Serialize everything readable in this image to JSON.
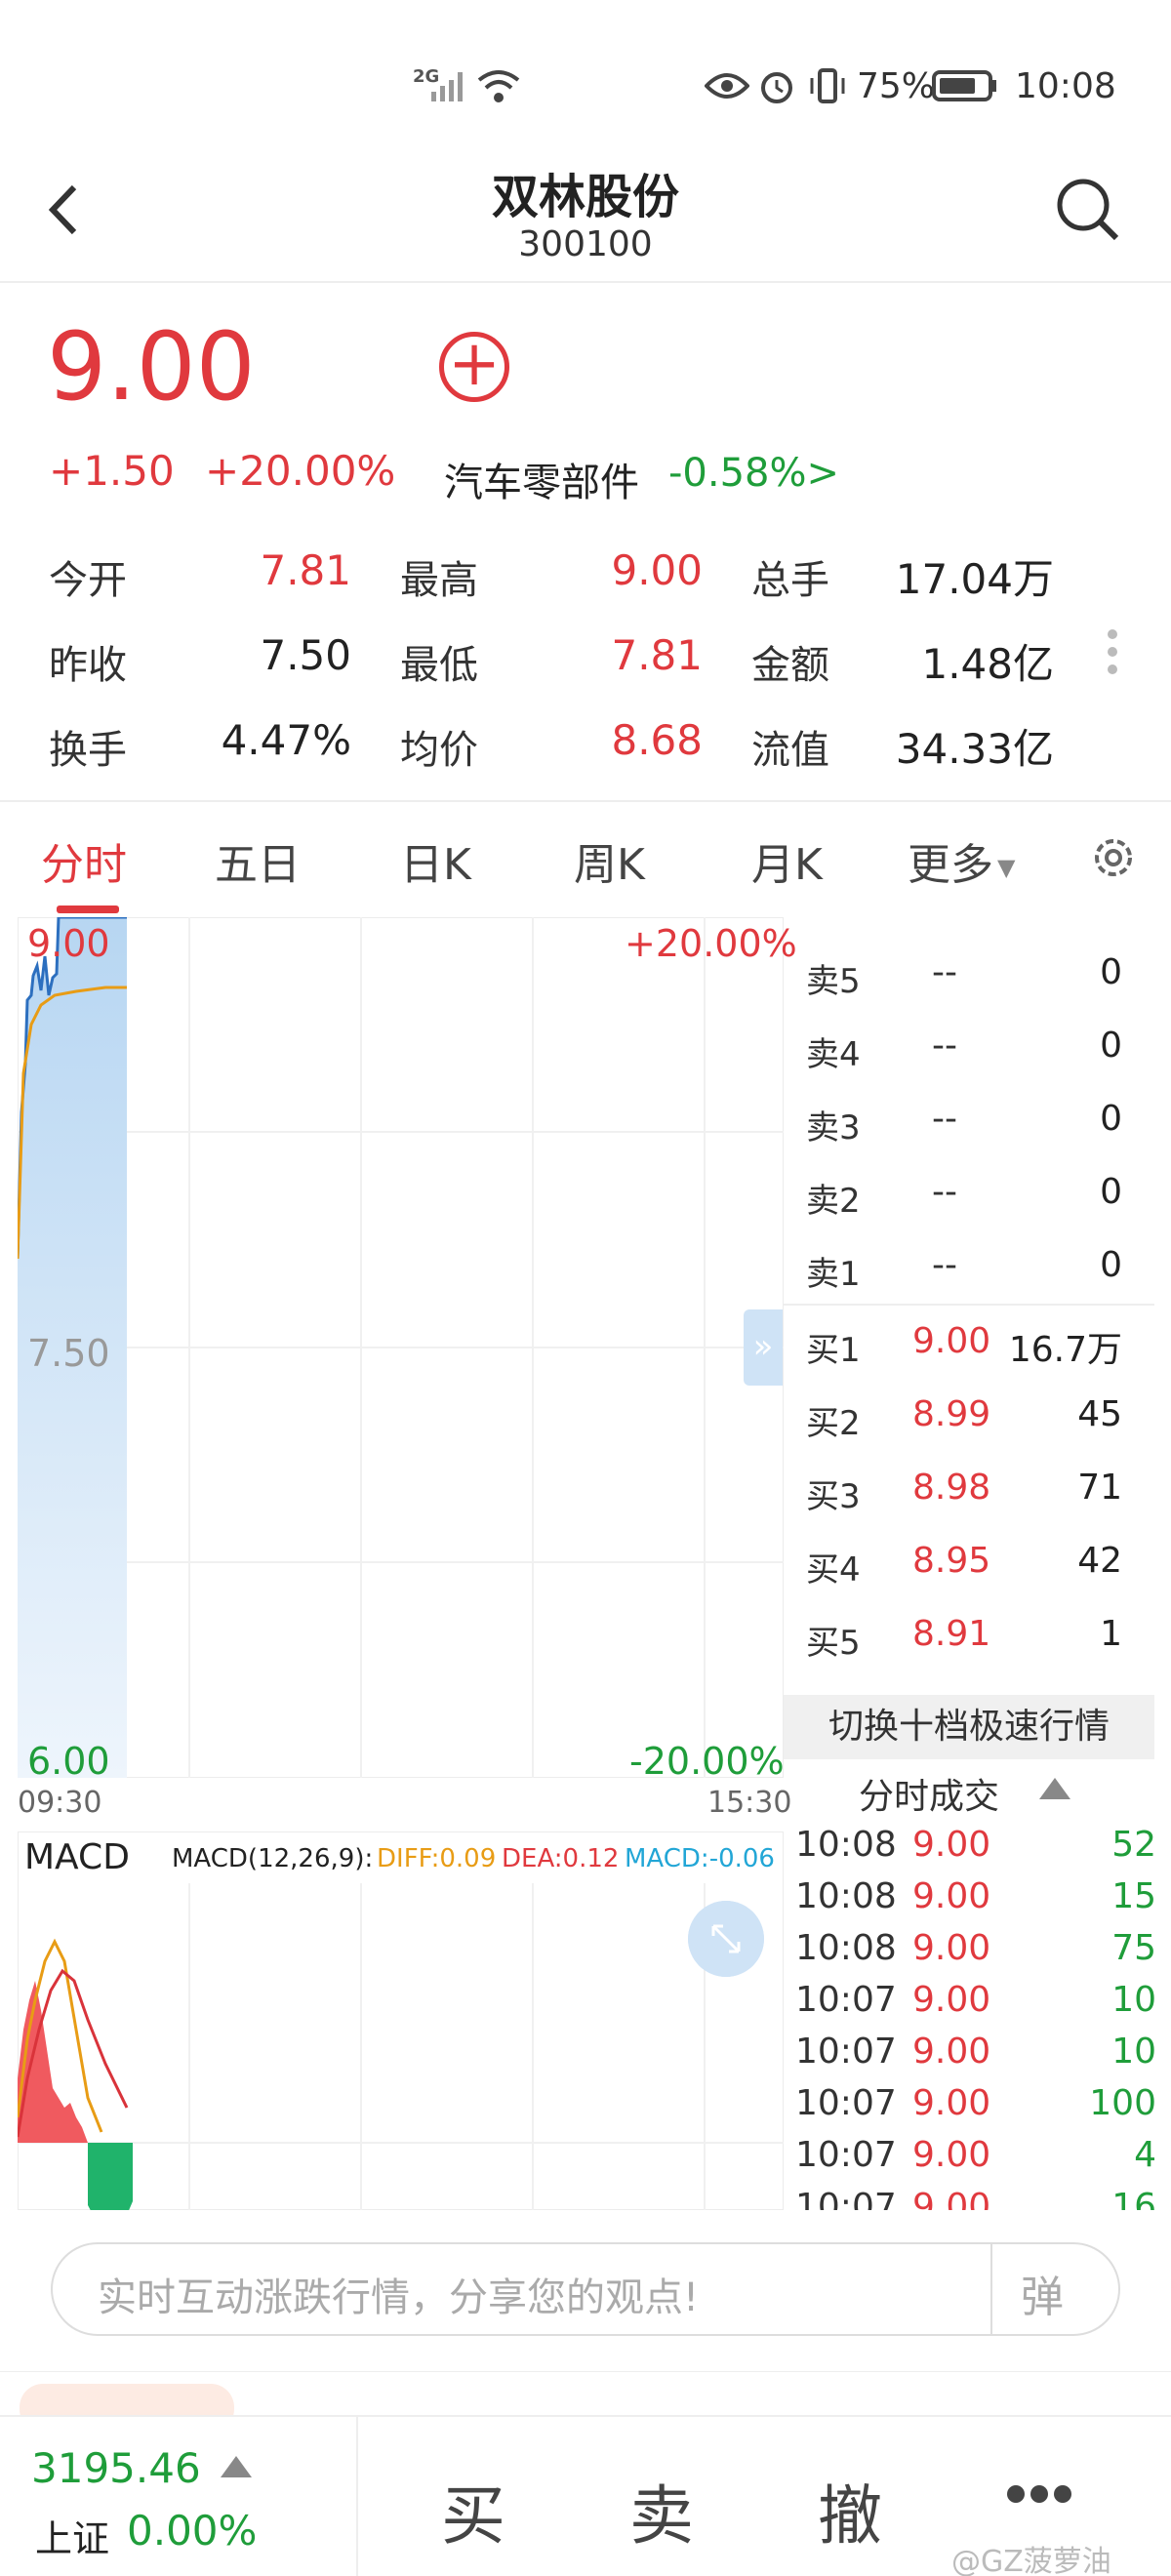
{
  "status_bar": {
    "signal": "2G",
    "battery": "75%",
    "time": "10:08"
  },
  "nav": {
    "title": "双林股份",
    "code": "300100"
  },
  "quote": {
    "price": "9.00",
    "change": "+1.50",
    "change_pct": "+20.00%",
    "sector": "汽车零部件",
    "sector_change": "-0.58%>",
    "fields": [
      {
        "label": "今开",
        "value": "7.81",
        "color": "#e0393e"
      },
      {
        "label": "最高",
        "value": "9.00",
        "color": "#e0393e"
      },
      {
        "label": "总手",
        "value": "17.04万",
        "color": "#222222"
      },
      {
        "label": "昨收",
        "value": "7.50",
        "color": "#222222"
      },
      {
        "label": "最低",
        "value": "7.81",
        "color": "#e0393e"
      },
      {
        "label": "金额",
        "value": "1.48亿",
        "color": "#222222"
      },
      {
        "label": "换手",
        "value": "4.47%",
        "color": "#222222"
      },
      {
        "label": "均价",
        "value": "8.68",
        "color": "#e0393e"
      },
      {
        "label": "流值",
        "value": "34.33亿",
        "color": "#222222"
      }
    ]
  },
  "tabs": [
    "分时",
    "五日",
    "日K",
    "周K",
    "月K",
    "更多"
  ],
  "chart": {
    "price_high": "9.00",
    "price_mid": "7.50",
    "price_low": "6.00",
    "pct_high": "+20.00%",
    "pct_low": "-20.00%",
    "time_open": "09:30",
    "time_close": "15:30"
  },
  "macd": {
    "label": "MACD",
    "params": "MACD(12,26,9):",
    "diff": "DIFF:0.09",
    "dea": "DEA:0.12",
    "macd": "MACD:-0.06"
  },
  "order_book": {
    "sell": [
      {
        "label": "卖5",
        "price": "--",
        "vol": "0"
      },
      {
        "label": "卖4",
        "price": "--",
        "vol": "0"
      },
      {
        "label": "卖3",
        "price": "--",
        "vol": "0"
      },
      {
        "label": "卖2",
        "price": "--",
        "vol": "0"
      },
      {
        "label": "卖1",
        "price": "--",
        "vol": "0"
      }
    ],
    "buy": [
      {
        "label": "买1",
        "price": "9.00",
        "vol": "16.7万"
      },
      {
        "label": "买2",
        "price": "8.99",
        "vol": "45"
      },
      {
        "label": "买3",
        "price": "8.98",
        "vol": "71"
      },
      {
        "label": "买4",
        "price": "8.95",
        "vol": "42"
      },
      {
        "label": "买5",
        "price": "8.91",
        "vol": "1"
      }
    ],
    "switch_label": "切换十档极速行情",
    "trades_title": "分时成交"
  },
  "trades": [
    {
      "time": "10:08",
      "price": "9.00",
      "vol": "52"
    },
    {
      "time": "10:08",
      "price": "9.00",
      "vol": "15"
    },
    {
      "time": "10:08",
      "price": "9.00",
      "vol": "75"
    },
    {
      "time": "10:07",
      "price": "9.00",
      "vol": "10"
    },
    {
      "time": "10:07",
      "price": "9.00",
      "vol": "10"
    },
    {
      "time": "10:07",
      "price": "9.00",
      "vol": "100"
    },
    {
      "time": "10:07",
      "price": "9.00",
      "vol": "4"
    },
    {
      "time": "10:07",
      "price": "9.00",
      "vol": "16"
    }
  ],
  "comment": {
    "placeholder": "实时互动涨跌行情，分享您的观点!",
    "danmu_label": "弹"
  },
  "bottom": {
    "index_value": "3195.46",
    "index_name": "上证",
    "index_pct": "0.00%",
    "buy": "买",
    "sell": "卖",
    "cancel": "撤"
  },
  "watermark": "@GZ菠萝油"
}
